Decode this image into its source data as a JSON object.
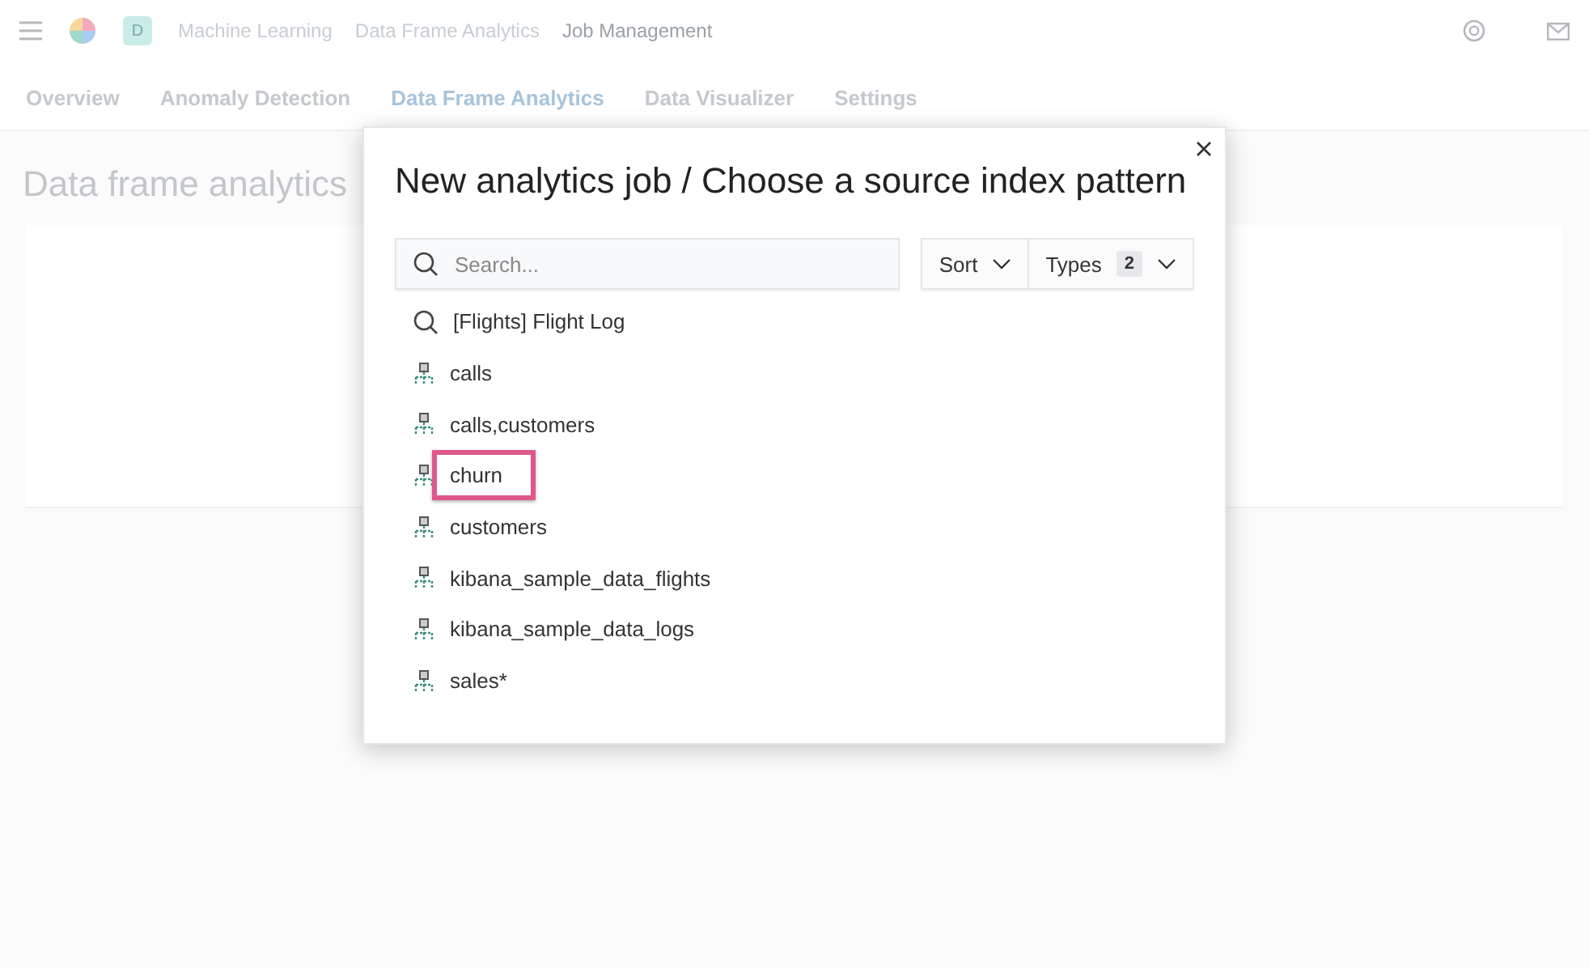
{
  "header": {
    "avatar": "D",
    "breadcrumbs": [
      {
        "label": "Machine Learning",
        "current": false
      },
      {
        "label": "Data Frame Analytics",
        "current": false
      },
      {
        "label": "Job Management",
        "current": true
      }
    ]
  },
  "tabs": [
    {
      "label": "Overview",
      "selected": false
    },
    {
      "label": "Anomaly Detection",
      "selected": false
    },
    {
      "label": "Data Frame Analytics",
      "selected": true
    },
    {
      "label": "Data Visualizer",
      "selected": false
    },
    {
      "label": "Settings",
      "selected": false
    }
  ],
  "page": {
    "title": "Data frame analytics"
  },
  "modal": {
    "title": "New analytics job / Choose a source index pattern",
    "search": {
      "placeholder": "Search..."
    },
    "sort": {
      "label": "Sort"
    },
    "types": {
      "label": "Types",
      "count": "2"
    },
    "items": [
      {
        "label": "[Flights] Flight Log",
        "kind": "saved_search",
        "highlighted": false
      },
      {
        "label": "calls",
        "kind": "index_pattern",
        "highlighted": false
      },
      {
        "label": "calls,customers",
        "kind": "index_pattern",
        "highlighted": false
      },
      {
        "label": "churn",
        "kind": "index_pattern",
        "highlighted": true
      },
      {
        "label": "customers",
        "kind": "index_pattern",
        "highlighted": false
      },
      {
        "label": "kibana_sample_data_flights",
        "kind": "index_pattern",
        "highlighted": false
      },
      {
        "label": "kibana_sample_data_logs",
        "kind": "index_pattern",
        "highlighted": false
      },
      {
        "label": "sales*",
        "kind": "index_pattern",
        "highlighted": false
      }
    ]
  }
}
